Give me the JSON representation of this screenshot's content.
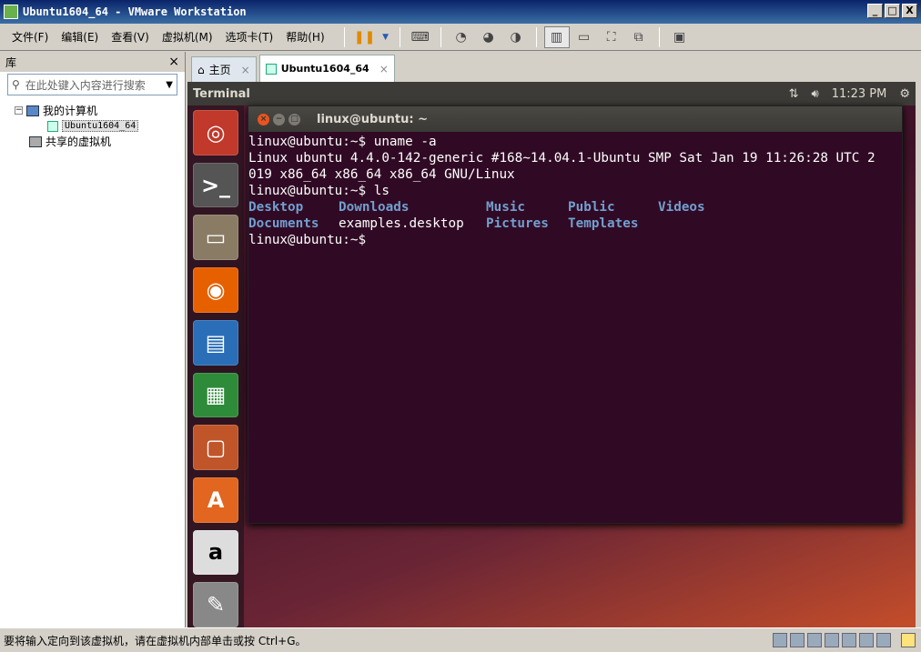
{
  "window": {
    "title": "Ubuntu1604_64 - VMware Workstation",
    "min": "_",
    "max": "□",
    "close": "X"
  },
  "menu": [
    "文件(F)",
    "编辑(E)",
    "查看(V)",
    "虚拟机(M)",
    "选项卡(T)",
    "帮助(H)"
  ],
  "sidebar": {
    "title": "库",
    "close": "×",
    "search_placeholder": "在此处键入内容进行搜索",
    "tree": {
      "my_computer": "我的计算机",
      "vm": "Ubuntu1604_64",
      "shared": "共享的虚拟机"
    }
  },
  "tabs": [
    {
      "label": "主页"
    },
    {
      "label": "Ubuntu1604_64"
    }
  ],
  "guest": {
    "panel_title": "Terminal",
    "time": "11:23 PM",
    "terminal_title": "linux@ubuntu: ~",
    "lines": [
      "linux@ubuntu:~$ uname -a",
      "Linux ubuntu 4.4.0-142-generic #168~14.04.1-Ubuntu SMP Sat Jan 19 11:26:28 UTC 2",
      "019 x86_64 x86_64 x86_64 GNU/Linux",
      "linux@ubuntu:~$ ls"
    ],
    "ls": {
      "row1": [
        "Desktop",
        "Downloads",
        "Music",
        "Public",
        "Videos"
      ],
      "row2": [
        "Documents",
        "examples.desktop",
        "Pictures",
        "Templates"
      ]
    },
    "prompt": "linux@ubuntu:~$"
  },
  "status": {
    "text": "要将输入定向到该虚拟机，请在虚拟机内部单击或按 Ctrl+G。"
  }
}
